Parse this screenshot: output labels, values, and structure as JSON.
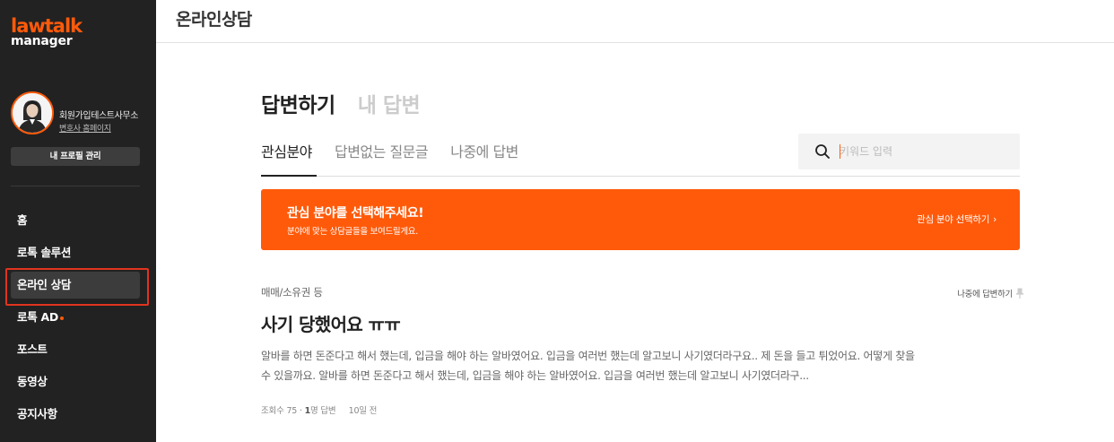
{
  "sidebar": {
    "logo_main": "lawtalk",
    "logo_sub": "manager",
    "profile_name": "회원가입테스트사무소",
    "profile_link": "변호사 홈페이지",
    "profile_button": "내 프로필 관리",
    "items": [
      {
        "label": "홈"
      },
      {
        "label": "로톡 솔루션"
      },
      {
        "label": "온라인 상담"
      },
      {
        "label": "로톡 AD"
      },
      {
        "label": "포스트"
      },
      {
        "label": "동영상"
      },
      {
        "label": "공지사항"
      }
    ]
  },
  "header": {
    "title": "온라인상담"
  },
  "main": {
    "tabs": [
      {
        "label": "답변하기"
      },
      {
        "label": "내 답변"
      }
    ],
    "sub_tabs": [
      {
        "label": "관심분야"
      },
      {
        "label": "답변없는 질문글"
      },
      {
        "label": "나중에 답변"
      }
    ],
    "search": {
      "placeholder": "키워드 입력",
      "icon": "search-icon"
    },
    "banner": {
      "title": "관심 분야를 선택해주세요!",
      "subtitle": "분야에 맞는 상담글들을 보여드릴게요.",
      "link": "관심 분야 선택하기",
      "color": "#ff5a0a"
    },
    "question": {
      "category": "매매/소유권 등",
      "later_label": "나중에 답변하기",
      "title": "사기 당했어요 ㅠㅠ",
      "body": "알바를 하면 돈준다고 해서 했는데, 입금을 해야 하는 알바였어요. 입금을 여러번 했는데 알고보니 사기였더라구요.. 제 돈을 들고 튀었어요. 어떻게 찾을 수 있을까요. 알바를 하면 돈준다고 해서 했는데, 입금을 해야 하는 알바였어요. 입금을 여러번 했는데 알고보니 사기였더라구...",
      "views_label": "조회수 75",
      "answers_count": "1",
      "answers_label": "명 답변",
      "time": "10일 전"
    }
  },
  "colors": {
    "accent": "#ff5a0a",
    "sidebar_bg": "#222222",
    "highlight_box": "#e0341e"
  }
}
